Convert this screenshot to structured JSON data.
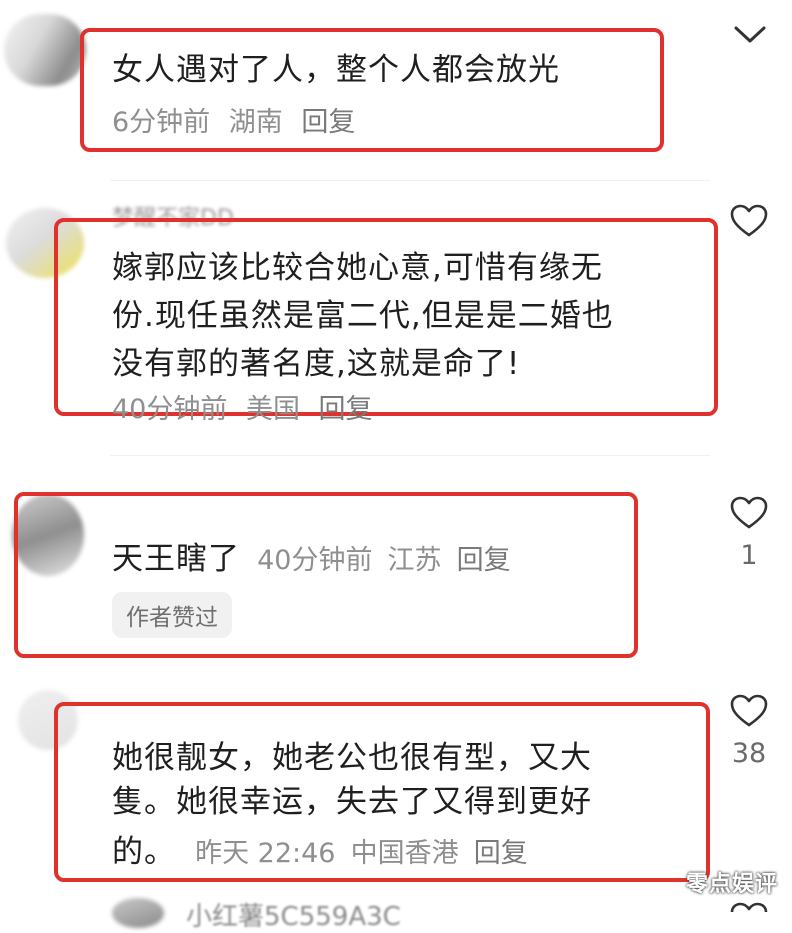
{
  "comments": [
    {
      "name": "",
      "text_lines": [
        "女人遇对了人，整个人都会放光"
      ],
      "time": "6分钟前",
      "location": "湖南",
      "reply": "回复"
    },
    {
      "name": "梦醒不家DD",
      "text_lines": [
        "嫁郭应该比较合她心意,可惜有缘无",
        "份.现任虽然是富二代,但是是二婚也",
        "没有郭的著名度,这就是命了!"
      ],
      "time": "40分钟前",
      "location": "美国",
      "reply": "回复"
    },
    {
      "name": "",
      "text": "天王瞎了",
      "time": "40分钟前",
      "location": "江苏",
      "reply": "回复",
      "tag": "作者赞过",
      "likes": "1"
    },
    {
      "name": "",
      "text_lines": [
        "她很靓女，她老公也很有型，又大",
        "隻。她很幸运，失去了又得到更好"
      ],
      "last_line": "的。",
      "time": "昨天 22:46",
      "location": "中国香港",
      "reply": "回复",
      "likes": "38"
    },
    {
      "name": "小红薯5C559A3C"
    }
  ],
  "watermark": "零点娱评",
  "colors": {
    "highlight": "#e0322c"
  },
  "icons": {
    "collapse": "chevron-down-icon",
    "like": "heart-outline-icon"
  }
}
